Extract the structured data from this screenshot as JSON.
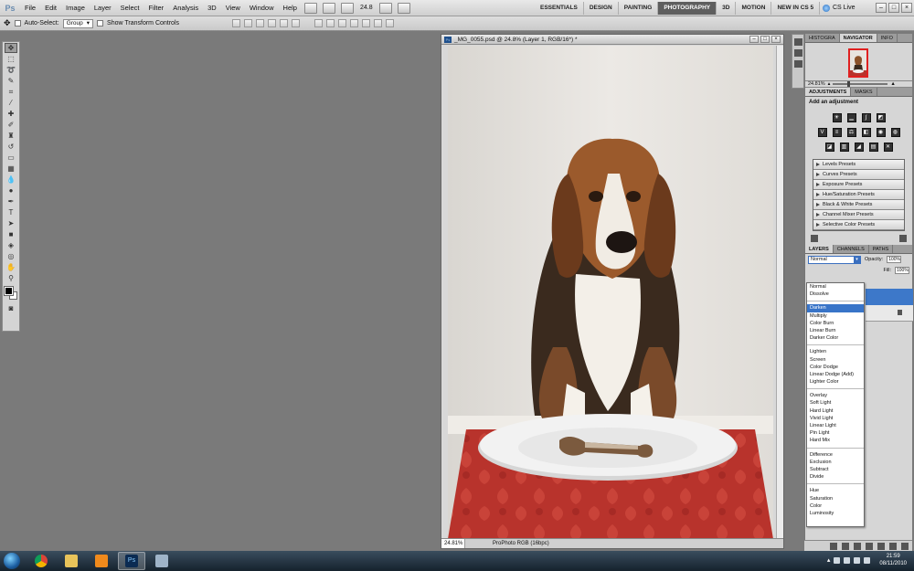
{
  "app": {
    "logo": "Ps",
    "menu": [
      "File",
      "Edit",
      "Image",
      "Layer",
      "Select",
      "Filter",
      "Analysis",
      "3D",
      "View",
      "Window",
      "Help"
    ],
    "zoom": "24.8",
    "workspaces": [
      "ESSENTIALS",
      "DESIGN",
      "PAINTING",
      "PHOTOGRAPHY",
      "3D",
      "MOTION",
      "NEW IN CS 5"
    ],
    "active_workspace": "PHOTOGRAPHY",
    "cs_live": "CS Live"
  },
  "options_bar": {
    "auto_select_label": "Auto-Select:",
    "auto_select_value": "Group",
    "transform_label": "Show Transform Controls"
  },
  "document": {
    "title": "_MG_0055.psd @ 24.8% (Layer 1, RGB/16*) *",
    "status_zoom": "24.81%",
    "status_profile": "ProPhoto RGB (16bpc)"
  },
  "navigator": {
    "tabs": [
      "HISTOGRA",
      "NAVIGATOR",
      "INFO"
    ],
    "active": "NAVIGATOR",
    "zoom": "24.81%"
  },
  "adjustments": {
    "tabs": [
      "ADJUSTMENTS",
      "MASKS"
    ],
    "active": "ADJUSTMENTS",
    "title": "Add an adjustment",
    "presets": [
      "Levels Presets",
      "Curves Presets",
      "Exposure Presets",
      "Hue/Saturation Presets",
      "Black & White Presets",
      "Channel Mixer Presets",
      "Selective Color Presets"
    ]
  },
  "layers": {
    "tabs": [
      "LAYERS",
      "CHANNELS",
      "PATHS"
    ],
    "active": "LAYERS",
    "blend_mode": "Normal",
    "opacity_label": "Opacity:",
    "opacity": "100%",
    "fill_label": "Fill:",
    "fill": "100%"
  },
  "blend_modes": {
    "groups": [
      [
        "Normal",
        "Dissolve"
      ],
      [
        "Darken",
        "Multiply",
        "Color Burn",
        "Linear Burn",
        "Darker Color"
      ],
      [
        "Lighten",
        "Screen",
        "Color Dodge",
        "Linear Dodge (Add)",
        "Lighter Color"
      ],
      [
        "Overlay",
        "Soft Light",
        "Hard Light",
        "Vivid Light",
        "Linear Light",
        "Pin Light",
        "Hard Mix"
      ],
      [
        "Difference",
        "Exclusion",
        "Subtract",
        "Divide"
      ],
      [
        "Hue",
        "Saturation",
        "Color",
        "Luminosity"
      ]
    ],
    "highlighted": "Darken"
  },
  "taskbar": {
    "time": "21:59",
    "date": "08/11/2010"
  },
  "colors": {
    "accent": "#3874c8",
    "canvas_bg": "#7a7a7a",
    "nav_frame": "#e02020"
  }
}
